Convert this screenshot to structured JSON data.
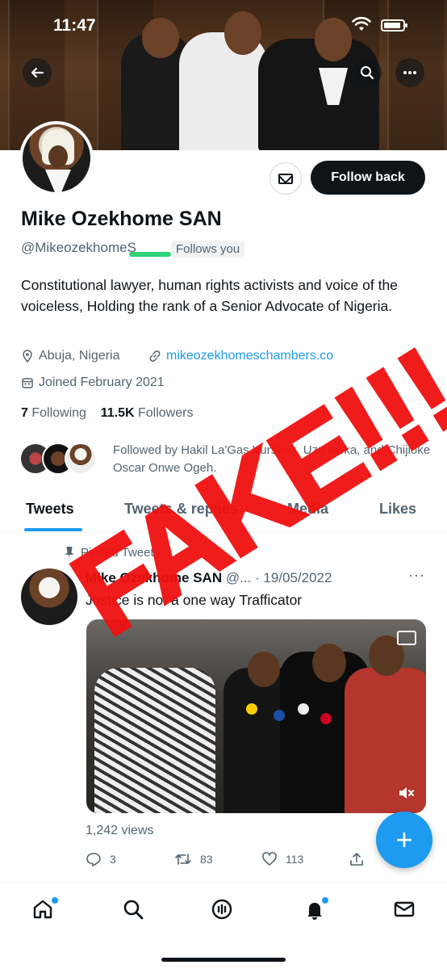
{
  "status_bar": {
    "time": "11:47"
  },
  "profile": {
    "name": "Mike Ozekhome SAN",
    "handle": "@MikeozekhomeS",
    "follows_you_badge": "Follows you",
    "follow_button": "Follow back",
    "bio": "Constitutional lawyer, human rights activists and voice of the voiceless, Holding the rank of a Senior Advocate of Nigeria.",
    "location": "Abuja, Nigeria",
    "website": "mikeozekhomeschambers.co",
    "joined": "Joined February 2021",
    "following_count": "7",
    "following_label": "Following",
    "followers_count": "11.5K",
    "followers_label": "Followers",
    "followed_by": "Followed by Hakil La'Gas Vurshak, Uzu Awka, and Chijioke Oscar Onwe Ogeh."
  },
  "tabs": [
    {
      "label": "Tweets",
      "active": true
    },
    {
      "label": "Tweets & replies",
      "active": false
    },
    {
      "label": "Media",
      "active": false
    },
    {
      "label": "Likes",
      "active": false
    }
  ],
  "tweet": {
    "pinned_label": "Pinned Tweet",
    "author_name": "Mike Ozekhome SAN",
    "author_meta": "@... · 19/05/2022",
    "text": "Justice is not a one way Trafficator",
    "views": "1,242 views",
    "replies": "3",
    "retweets": "83",
    "likes": "113"
  },
  "overlay_stamp": "FAKE!!!",
  "icons": {
    "back": "arrow-left-icon",
    "search": "search-icon",
    "more": "more-horizontal-icon",
    "message": "envelope-icon",
    "location": "location-pin-icon",
    "link": "link-icon",
    "calendar": "calendar-icon",
    "pin": "pin-icon",
    "reply": "reply-icon",
    "retweet": "retweet-icon",
    "like": "heart-icon",
    "share": "share-icon",
    "compose": "plus-icon",
    "home": "home-icon",
    "explore": "search-icon",
    "spaces": "spaces-icon",
    "notifications": "bell-icon",
    "messages": "envelope-icon"
  },
  "colors": {
    "accent": "#1d9bf0",
    "text": "#0f1419",
    "muted": "#536471",
    "stamp": "#f01010"
  }
}
